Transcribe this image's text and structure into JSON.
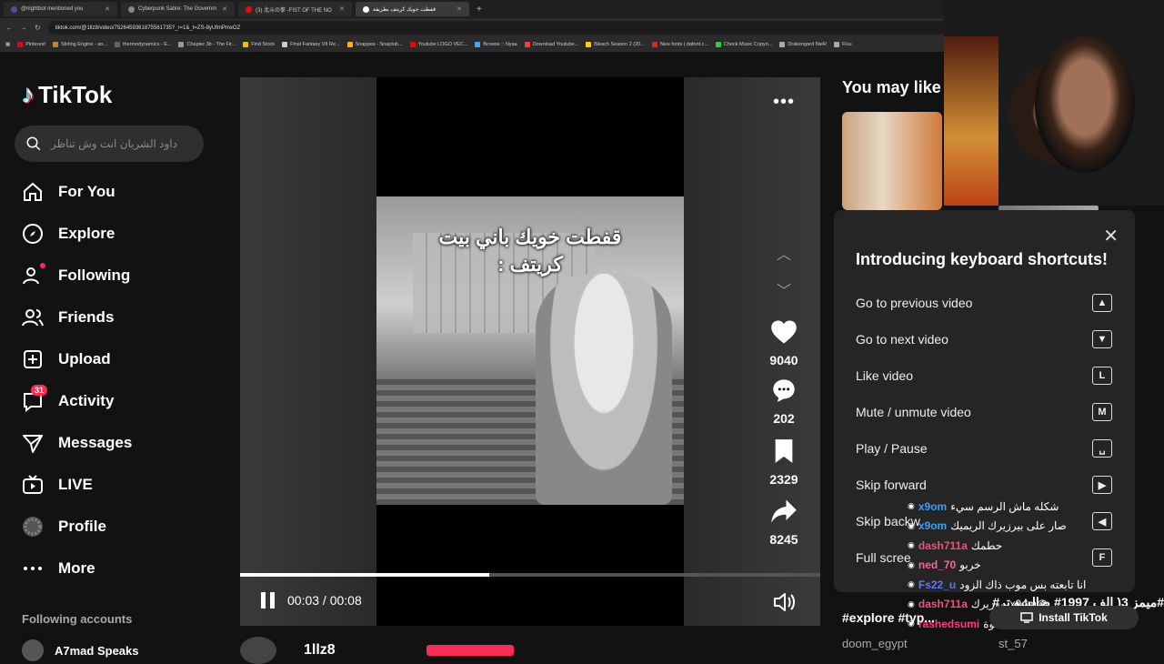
{
  "browser": {
    "tabs": [
      {
        "label": "@nightbot mentioned you",
        "color": "#6441a5"
      },
      {
        "label": "Cyberpunk Satire: The Governm",
        "color": "#888"
      },
      {
        "label": "(3) 北斗の拳 -FIST OF THE NO",
        "color": "#ff0000"
      },
      {
        "label": "قفطت خويك كريتف بطريقة",
        "color": "#ffffff"
      }
    ],
    "url": "tiktok.com/@1llz8/video/7526459361875561735?_r=1&_t=ZS-8yUfmPmxOZ",
    "bookmarks": [
      {
        "label": "Pinterest",
        "color": "#e60023"
      },
      {
        "label": "Stirling Engine - an...",
        "color": "#c08040"
      },
      {
        "label": "thermodynamics - E...",
        "color": "#666"
      },
      {
        "label": "Chapter 3b - The Fir...",
        "color": "#999"
      },
      {
        "label": "Find Stock",
        "color": "#f0c000"
      },
      {
        "label": "Final Fantasy VII Re...",
        "color": "#ccc"
      },
      {
        "label": "Snappea - Snaptub...",
        "color": "#ffb400"
      },
      {
        "label": "Youtube LOGO VEC...",
        "color": "#ff0000"
      },
      {
        "label": "Browse :: Nyaa",
        "color": "#4fa3ff"
      },
      {
        "label": "Download Youtube...",
        "color": "#ff3b3b"
      },
      {
        "label": "Bleach Season 2 (20...",
        "color": "#ffd000"
      },
      {
        "label": "New fonts | dafont.c...",
        "color": "#d22"
      },
      {
        "label": "Check Music Copyri...",
        "color": "#2ecc40"
      },
      {
        "label": "Drakengard NieR",
        "color": "#aaa"
      },
      {
        "label": "Fluu",
        "color": "#aaa"
      }
    ]
  },
  "sidebar": {
    "brand": "TikTok",
    "search_placeholder": "داود الشريان انت وش تناظر",
    "items": [
      {
        "label": "For You",
        "icon": "home-icon"
      },
      {
        "label": "Explore",
        "icon": "compass-icon"
      },
      {
        "label": "Following",
        "icon": "user-follow-icon"
      },
      {
        "label": "Friends",
        "icon": "friends-icon"
      },
      {
        "label": "Upload",
        "icon": "plus-square-icon"
      },
      {
        "label": "Activity",
        "icon": "inbox-icon",
        "badge": "31"
      },
      {
        "label": "Messages",
        "icon": "send-icon"
      },
      {
        "label": "LIVE",
        "icon": "tv-icon"
      },
      {
        "label": "Profile",
        "icon": "avatar-icon"
      },
      {
        "label": "More",
        "icon": "ellipsis-icon"
      }
    ],
    "following_title": "Following accounts",
    "following_account": "A7mad Speaks"
  },
  "video": {
    "caption_line1": "قفطت خويك باني بيت",
    "caption_line2": "كريتف :",
    "likes": "9040",
    "comments": "202",
    "saves": "2329",
    "shares": "8245",
    "time": "00:03 / 00:08",
    "progress": 0.43,
    "author": "1llz8"
  },
  "right": {
    "you_may_like": "You may like",
    "popup": {
      "title": "Introducing keyboard shortcuts!",
      "shortcuts": [
        {
          "label": "Go to previous video",
          "key": "▲"
        },
        {
          "label": "Go to next video",
          "key": "▼"
        },
        {
          "label": "Like video",
          "key": "L"
        },
        {
          "label": "Mute / unmute video",
          "key": "M"
        },
        {
          "label": "Play / Pause",
          "key": "␣"
        },
        {
          "label": "Skip forward",
          "key": "▶"
        },
        {
          "label": "Skip backw",
          "key": "◀"
        },
        {
          "label": "Full scree",
          "key": "F"
        }
      ]
    },
    "hashtags": "#ميمز 3( الف 1997# ضالشه تر#",
    "hashtags2": "#explore #typ...",
    "install_label": "Install TikTok",
    "doom": "doom_egypt",
    "st": "st_57"
  },
  "chat": [
    {
      "user": "x9om",
      "color": "#3ba0ff",
      "text": "شكله ماش الرسم سيء"
    },
    {
      "user": "x9om",
      "color": "#3ba0ff",
      "text": "صار على بيرزيرك الريميك"
    },
    {
      "user": "dash711a",
      "color": "#e05a7a",
      "text": "حطمك"
    },
    {
      "user": "ned_70",
      "color": "#ff5fa2",
      "text": "خربو"
    },
    {
      "user": "Fs22_u",
      "color": "#5a7bff",
      "text": "انا تابعته بس موب ذاك الزود"
    },
    {
      "user": "dash711a",
      "color": "#e05a7a",
      "text": "@x9om بيرزيرك"
    },
    {
      "user": "rashedsumi",
      "color": "#ff3b7a",
      "text": "@x9om نكته حلوة"
    }
  ]
}
